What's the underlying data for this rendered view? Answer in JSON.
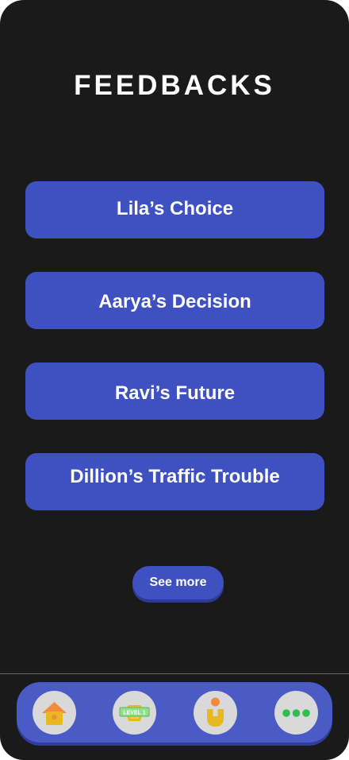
{
  "page": {
    "title": "FEEDBACKS"
  },
  "feedbacks": [
    {
      "label": "Lila’s Choice"
    },
    {
      "label": "Aarya’s Decision"
    },
    {
      "label": "Ravi’s Future"
    },
    {
      "label": "Dillion’s Traffic Trouble"
    }
  ],
  "see_more_label": "See more",
  "nav": {
    "items": [
      {
        "icon": "home-icon"
      },
      {
        "icon": "level-badge-icon",
        "badge_text": "LEVEL 1"
      },
      {
        "icon": "profile-icon"
      },
      {
        "icon": "more-icon"
      }
    ]
  },
  "colors": {
    "background": "#1b1a1b",
    "button": "#3f51c0",
    "nav_bar": "#4a5bc6",
    "nav_button": "#d9d9d9",
    "accent_orange": "#f58a3c",
    "accent_yellow": "#e8b820",
    "accent_green": "#2fbf4f"
  }
}
